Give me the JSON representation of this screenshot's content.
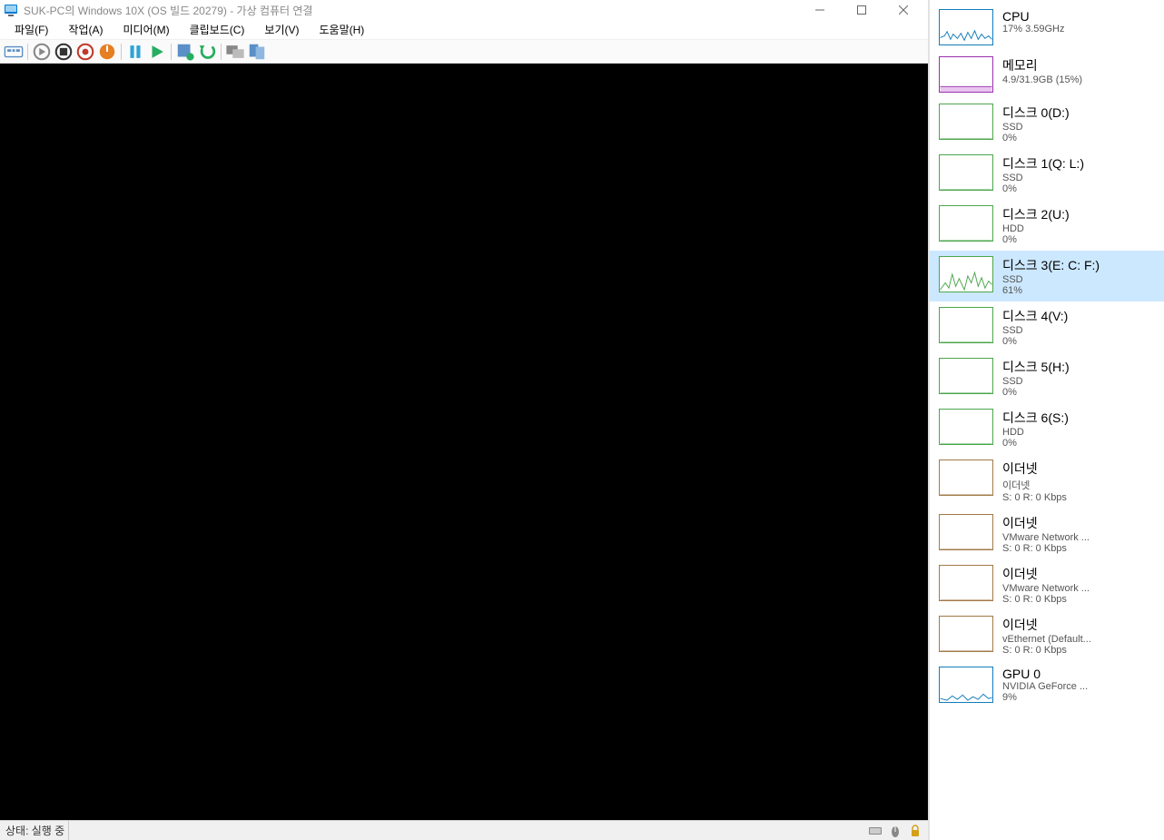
{
  "window": {
    "title": "SUK-PC의 Windows 10X (OS 빌드 20279) - 가상 컴퓨터 연결"
  },
  "menu": {
    "file": "파일(F)",
    "action": "작업(A)",
    "media": "미디어(M)",
    "clipboard": "클립보드(C)",
    "view": "보기(V)",
    "help": "도움말(H)"
  },
  "status": {
    "text": "상태: 실행 중"
  },
  "sidebar": {
    "items": [
      {
        "kind": "cpu",
        "title": "CPU",
        "sub1": "17% 3.59GHz",
        "sub2": "",
        "selected": false
      },
      {
        "kind": "mem",
        "title": "메모리",
        "sub1": "4.9/31.9GB (15%)",
        "sub2": "",
        "selected": false
      },
      {
        "kind": "disk",
        "title": "디스크 0(D:)",
        "sub1": "SSD",
        "sub2": "0%",
        "selected": false
      },
      {
        "kind": "disk",
        "title": "디스크 1(Q: L:)",
        "sub1": "SSD",
        "sub2": "0%",
        "selected": false
      },
      {
        "kind": "disk",
        "title": "디스크 2(U:)",
        "sub1": "HDD",
        "sub2": "0%",
        "selected": false
      },
      {
        "kind": "disk",
        "title": "디스크 3(E: C: F:)",
        "sub1": "SSD",
        "sub2": "61%",
        "selected": true
      },
      {
        "kind": "disk",
        "title": "디스크 4(V:)",
        "sub1": "SSD",
        "sub2": "0%",
        "selected": false
      },
      {
        "kind": "disk",
        "title": "디스크 5(H:)",
        "sub1": "SSD",
        "sub2": "0%",
        "selected": false
      },
      {
        "kind": "disk",
        "title": "디스크 6(S:)",
        "sub1": "HDD",
        "sub2": "0%",
        "selected": false
      },
      {
        "kind": "net",
        "title": "이더넷",
        "sub1": "이더넷",
        "sub2": "S: 0 R: 0 Kbps",
        "selected": false
      },
      {
        "kind": "net",
        "title": "이더넷",
        "sub1": "VMware Network ...",
        "sub2": "S: 0 R: 0 Kbps",
        "selected": false
      },
      {
        "kind": "net",
        "title": "이더넷",
        "sub1": "VMware Network ...",
        "sub2": "S: 0 R: 0 Kbps",
        "selected": false
      },
      {
        "kind": "net",
        "title": "이더넷",
        "sub1": "vEthernet (Default...",
        "sub2": "S: 0 R: 0 Kbps",
        "selected": false
      },
      {
        "kind": "gpu",
        "title": "GPU 0",
        "sub1": "NVIDIA GeForce ...",
        "sub2": "9%",
        "selected": false
      }
    ]
  }
}
